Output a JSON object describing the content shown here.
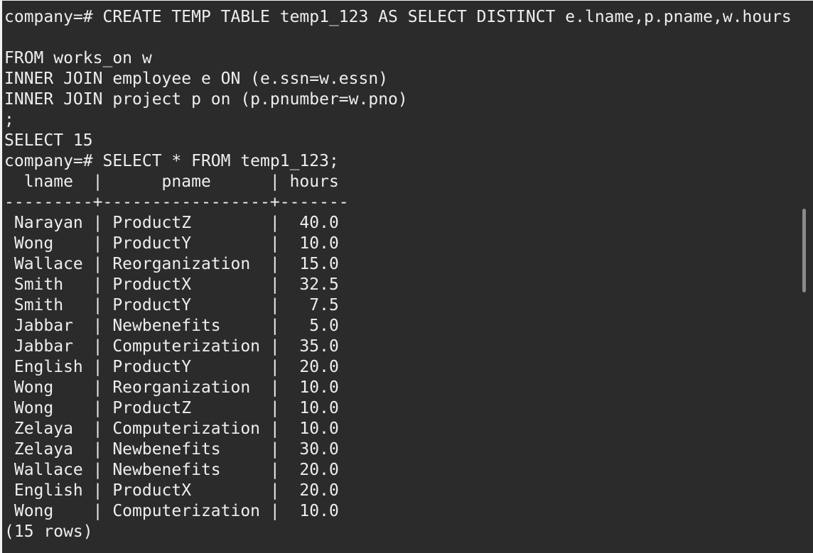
{
  "terminal": {
    "lines": [
      "company=# CREATE TEMP TABLE temp1_123 AS SELECT DISTINCT e.lname,p.pname,w.hours",
      "",
      "FROM works_on w",
      "INNER JOIN employee e ON (e.ssn=w.essn)",
      "INNER JOIN project p on (p.pnumber=w.pno)",
      ";",
      "SELECT 15",
      "company=# SELECT * FROM temp1_123;",
      "  lname  |      pname      | hours",
      "---------+-----------------+-------",
      " Narayan | ProductZ        |  40.0",
      " Wong    | ProductY        |  10.0",
      " Wallace | Reorganization  |  15.0",
      " Smith   | ProductX        |  32.5",
      " Smith   | ProductY        |   7.5",
      " Jabbar  | Newbenefits     |   5.0",
      " Jabbar  | Computerization |  35.0",
      " English | ProductY        |  20.0",
      " Wong    | Reorganization  |  10.0",
      " Wong    | ProductZ        |  10.0",
      " Zelaya  | Computerization |  10.0",
      " Zelaya  | Newbenefits     |  30.0",
      " Wallace | Newbenefits     |  20.0",
      " English | ProductX        |  20.0",
      " Wong    | Computerization |  10.0",
      "(15 rows)"
    ]
  },
  "colors": {
    "background": "#2b2b2b",
    "text": "#eeeeee",
    "scrollbar": "#8a8a8a"
  }
}
